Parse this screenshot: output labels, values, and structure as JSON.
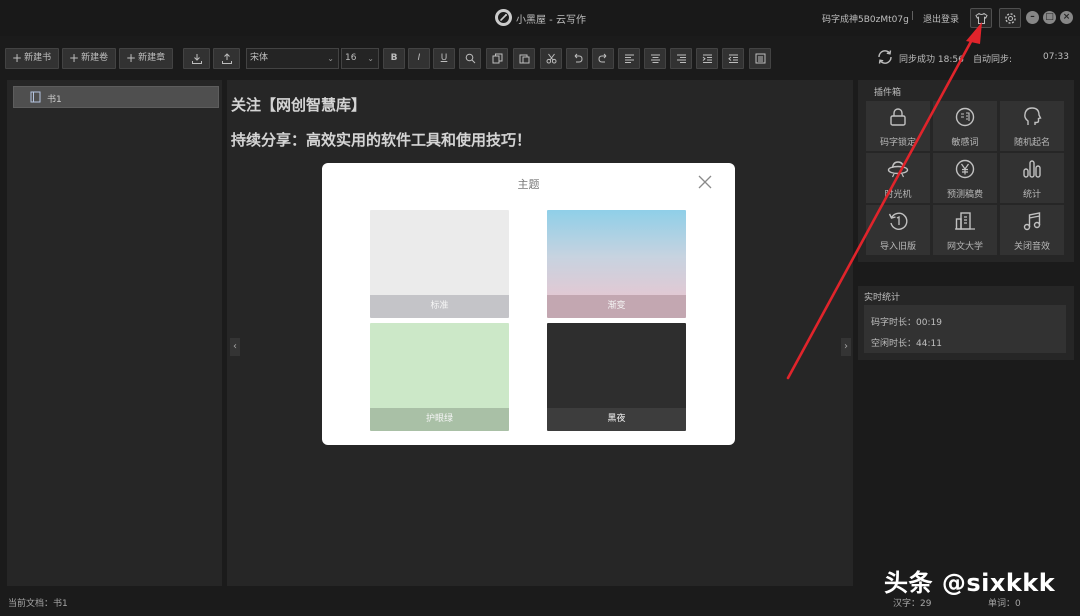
{
  "window": {
    "title": "小黑屋 - 云写作",
    "username": "码字成神5B0zMt07g",
    "separator": "|",
    "logout": "退出登录"
  },
  "toolbar": {
    "new_book": "新建书",
    "new_volume": "新建卷",
    "new_chapter": "新建章",
    "font_family": "宋体",
    "font_size": "16",
    "bold": "B",
    "italic": "I",
    "underline": "U",
    "sync_status": "同步成功 18:56",
    "autosync_label": "自动同步:",
    "clock": "07:33"
  },
  "sidebar": {
    "book": "书1"
  },
  "editor": {
    "line1": "关注【网创智慧库】",
    "line2": "持续分享：高效实用的软件工具和使用技巧！"
  },
  "plugins": {
    "title": "插件箱",
    "items": [
      {
        "label": "码字锁定",
        "icon": "lock-icon"
      },
      {
        "label": "敏感词",
        "icon": "sensitive-word-icon"
      },
      {
        "label": "随机起名",
        "icon": "head-silhouette-icon"
      },
      {
        "label": "时光机",
        "icon": "ufo-icon"
      },
      {
        "label": "预测稿费",
        "icon": "yen-icon"
      },
      {
        "label": "统计",
        "icon": "bar-chart-icon"
      },
      {
        "label": "导入旧版",
        "icon": "history-icon"
      },
      {
        "label": "网文大学",
        "icon": "building-icon"
      },
      {
        "label": "关闭音效",
        "icon": "music-note-icon"
      }
    ]
  },
  "stats": {
    "title": "实时统计",
    "typing_time": "码字时长：00:19",
    "idle_time": "空闲时长：44:11"
  },
  "statusbar": {
    "current_doc": "当前文档：书1",
    "char_count": "汉字：29",
    "word_count": "单词：0"
  },
  "theme_modal": {
    "title": "主题",
    "themes": [
      {
        "label": "标准"
      },
      {
        "label": "渐变"
      },
      {
        "label": "护眼绿"
      },
      {
        "label": "黑夜"
      }
    ]
  },
  "watermark": "头条 @sixkkk",
  "colors": {
    "background": "#1f1f1f",
    "panel": "#2c2c2c",
    "annotation_arrow": "#e0242b",
    "modal_bg": "#ffffff"
  }
}
